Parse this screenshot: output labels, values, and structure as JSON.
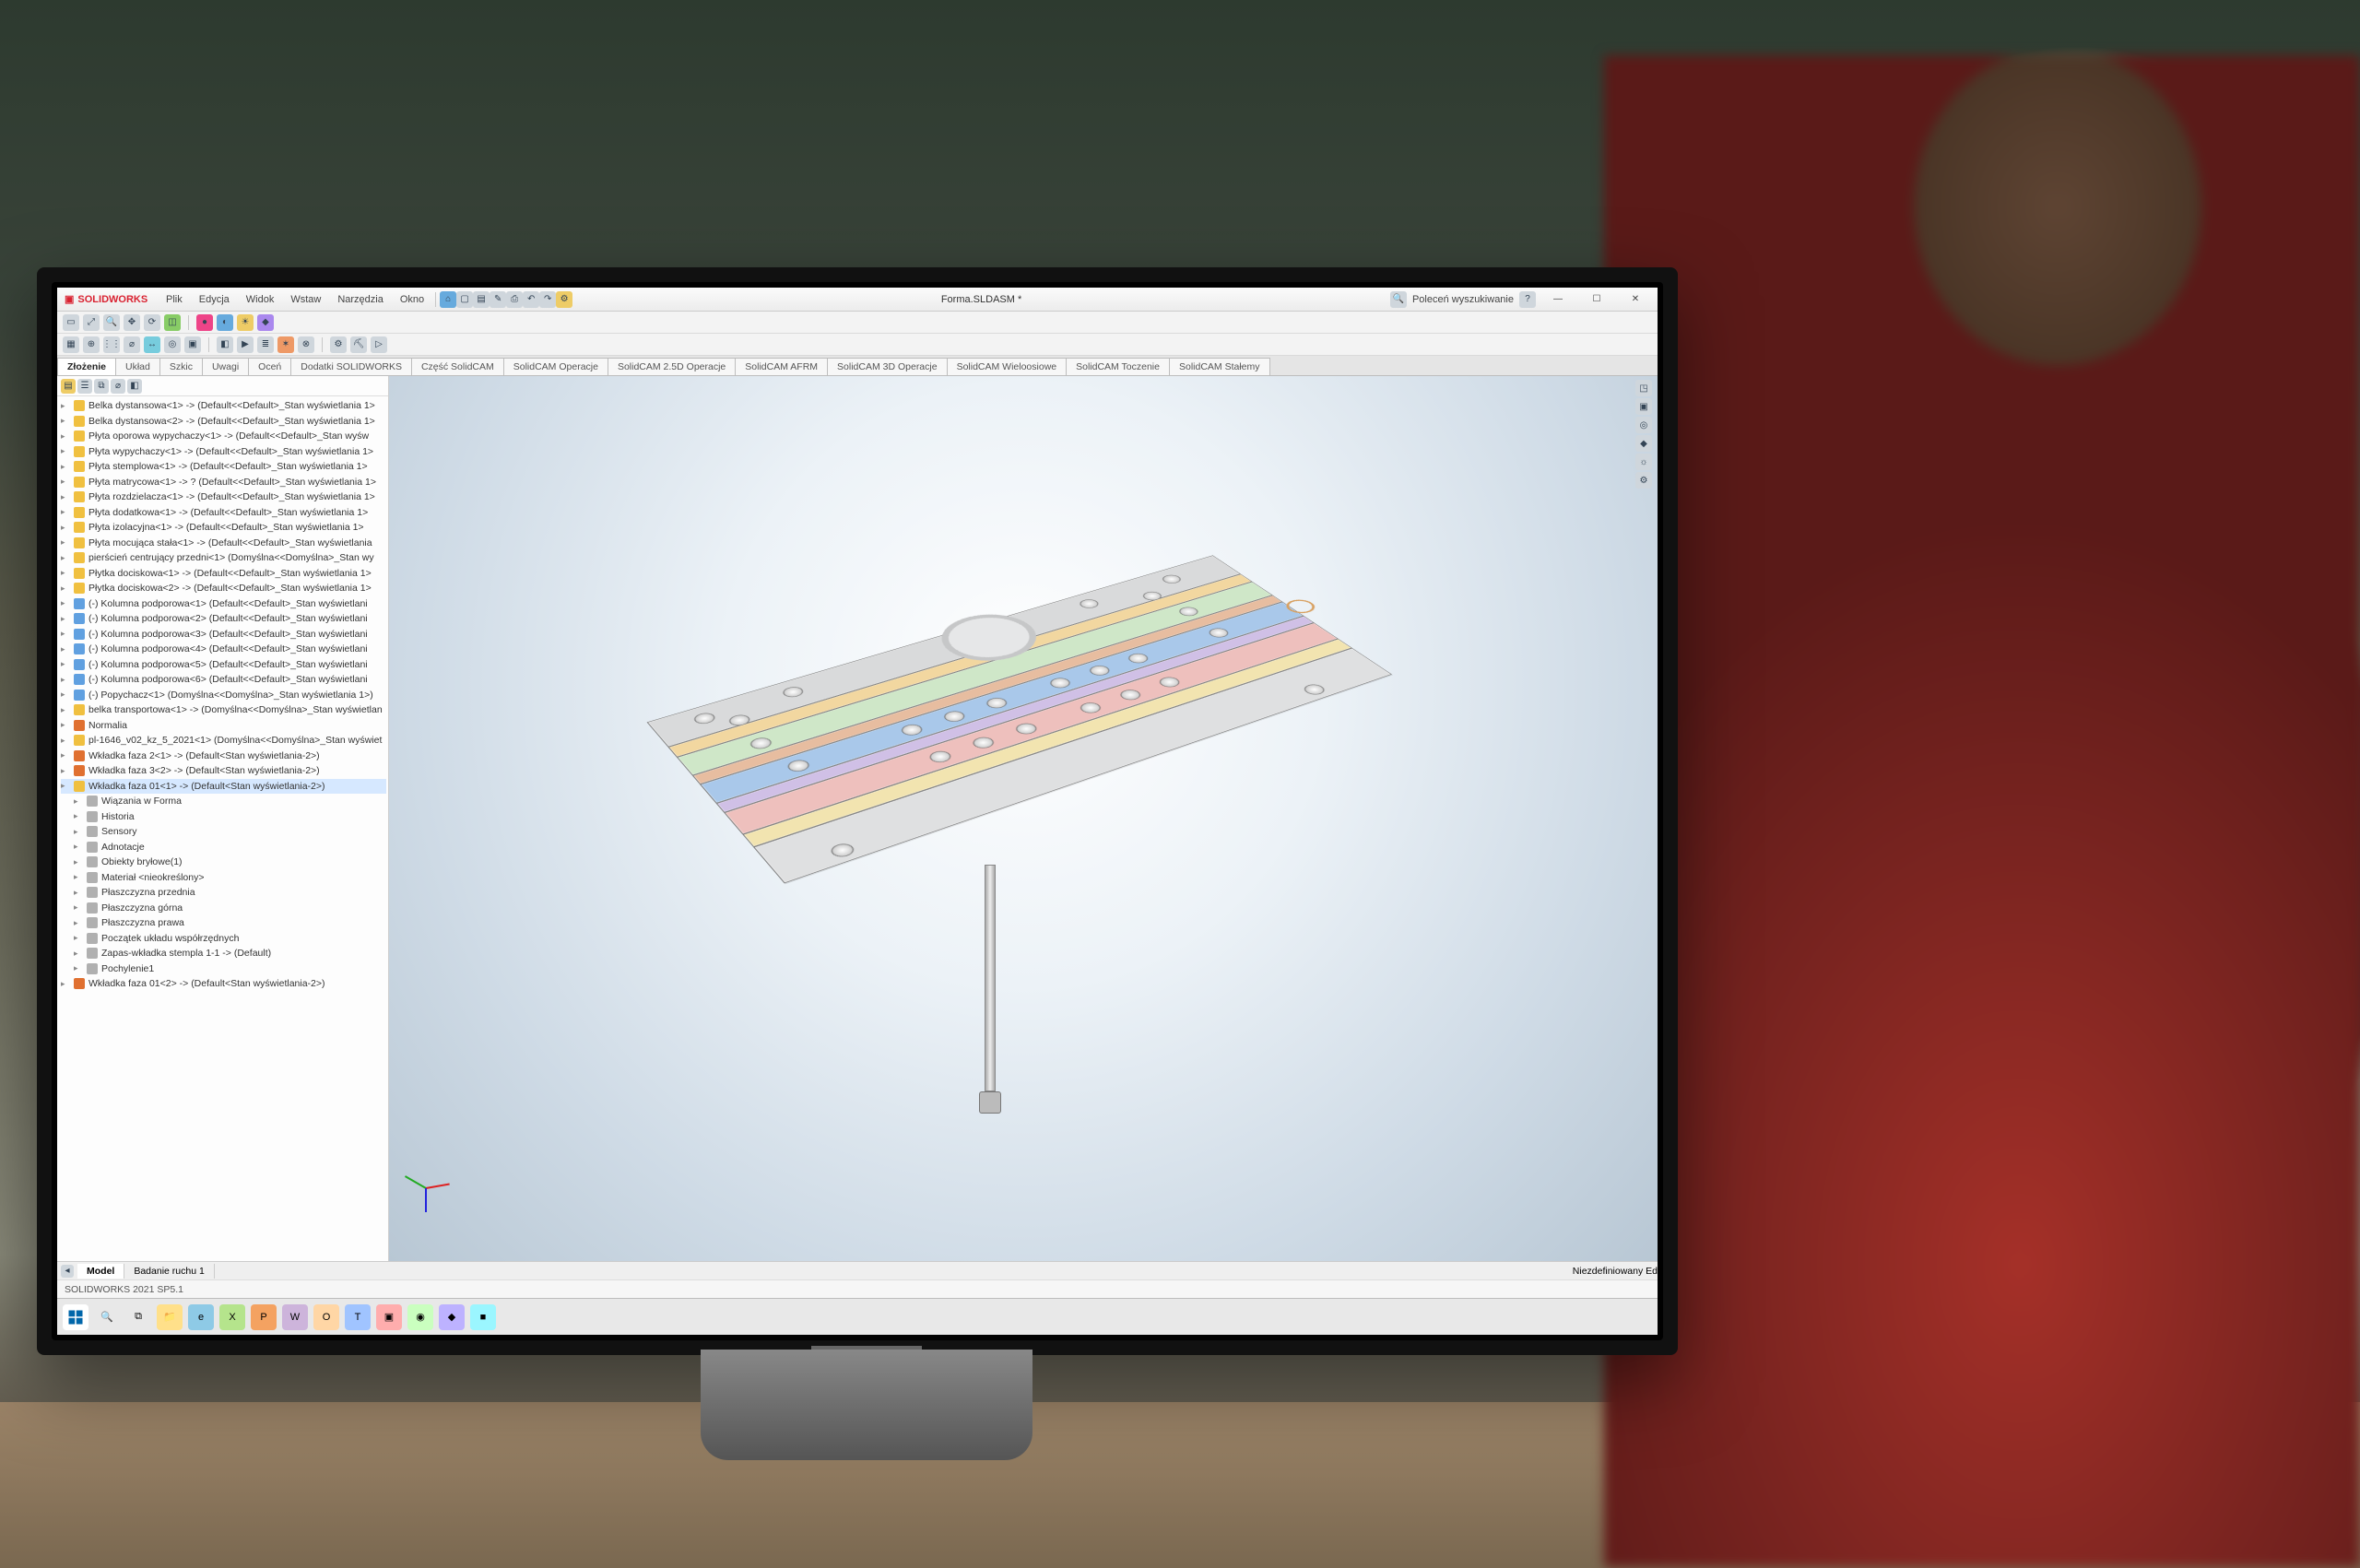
{
  "app": {
    "brand": "SOLIDWORKS",
    "document_title": "Forma.SLDASM *",
    "search_hint": "Poleceń wyszukiwanie"
  },
  "menu": [
    "Plik",
    "Edycja",
    "Widok",
    "Wstaw",
    "Narzędzia",
    "Okno"
  ],
  "ribbon_tabs": [
    "Złożenie",
    "Układ",
    "Szkic",
    "Uwagi",
    "Oceń",
    "Dodatki SOLIDWORKS",
    "Część SolidCAM",
    "SolidCAM Operacje",
    "SolidCAM 2.5D Operacje",
    "SolidCAM AFRM",
    "SolidCAM 3D Operacje",
    "SolidCAM Wieloosiowe",
    "SolidCAM Toczenie",
    "SolidCAM Stałemy"
  ],
  "active_tab": "Złożenie",
  "tree": [
    {
      "t": "Belka dystansowa<1> -> (Default<<Default>_Stan wyświetlania 1>",
      "k": "part"
    },
    {
      "t": "Belka dystansowa<2> -> (Default<<Default>_Stan wyświetlania 1>",
      "k": "part"
    },
    {
      "t": "Płyta oporowa wypychaczy<1> -> (Default<<Default>_Stan wyśw",
      "k": "part"
    },
    {
      "t": "Płyta wypychaczy<1> -> (Default<<Default>_Stan wyświetlania 1>",
      "k": "part"
    },
    {
      "t": "Płyta stemplowa<1> -> (Default<<Default>_Stan wyświetlania 1>",
      "k": "part"
    },
    {
      "t": "Płyta matrycowa<1> -> ? (Default<<Default>_Stan wyświetlania 1>",
      "k": "part"
    },
    {
      "t": "Płyta rozdzielacza<1> -> (Default<<Default>_Stan wyświetlania 1>",
      "k": "part"
    },
    {
      "t": "Płyta dodatkowa<1> -> (Default<<Default>_Stan wyświetlania 1>",
      "k": "part"
    },
    {
      "t": "Płyta izolacyjna<1> -> (Default<<Default>_Stan wyświetlania 1>",
      "k": "part"
    },
    {
      "t": "Płyta mocująca stała<1> -> (Default<<Default>_Stan wyświetlania",
      "k": "part"
    },
    {
      "t": "pierścień centrujący przedni<1> (Domyślna<<Domyślna>_Stan wy",
      "k": "part"
    },
    {
      "t": "Płytka dociskowa<1> -> (Default<<Default>_Stan wyświetlania 1>",
      "k": "part"
    },
    {
      "t": "Płytka dociskowa<2> -> (Default<<Default>_Stan wyświetlania 1>",
      "k": "part"
    },
    {
      "t": "(-) Kolumna podporowa<1> (Default<<Default>_Stan wyświetlani",
      "k": "sup"
    },
    {
      "t": "(-) Kolumna podporowa<2> (Default<<Default>_Stan wyświetlani",
      "k": "sup"
    },
    {
      "t": "(-) Kolumna podporowa<3> (Default<<Default>_Stan wyświetlani",
      "k": "sup"
    },
    {
      "t": "(-) Kolumna podporowa<4> (Default<<Default>_Stan wyświetlani",
      "k": "sup"
    },
    {
      "t": "(-) Kolumna podporowa<5> (Default<<Default>_Stan wyświetlani",
      "k": "sup"
    },
    {
      "t": "(-) Kolumna podporowa<6> (Default<<Default>_Stan wyświetlani",
      "k": "sup"
    },
    {
      "t": "(-) Popychacz<1> (Domyślna<<Domyślna>_Stan wyświetlania 1>)",
      "k": "sup"
    },
    {
      "t": "belka transportowa<1> -> (Domyślna<<Domyślna>_Stan wyświetlan",
      "k": "part"
    },
    {
      "t": "Normalia",
      "k": "warn"
    },
    {
      "t": "pl-1646_v02_kz_5_2021<1> (Domyślna<<Domyślna>_Stan wyświet",
      "k": "part"
    },
    {
      "t": "Wkładka faza 2<1> -> (Default<Stan wyświetlania-2>)",
      "k": "warn"
    },
    {
      "t": "Wkładka faza 3<2> -> (Default<Stan wyświetlania-2>)",
      "k": "warn"
    },
    {
      "t": "Wkładka faza 01<1> -> (Default<Stan wyświetlania-2>)",
      "k": "sel"
    },
    {
      "t": "Wiązania w Forma",
      "k": "sub",
      "i": 1
    },
    {
      "t": "Historia",
      "k": "sub",
      "i": 1
    },
    {
      "t": "Sensory",
      "k": "sub",
      "i": 1
    },
    {
      "t": "Adnotacje",
      "k": "sub",
      "i": 1
    },
    {
      "t": "Obiekty bryłowe(1)",
      "k": "sub",
      "i": 1
    },
    {
      "t": "Materiał <nieokreślony>",
      "k": "sub",
      "i": 1
    },
    {
      "t": "Płaszczyzna przednia",
      "k": "sub",
      "i": 1
    },
    {
      "t": "Płaszczyzna górna",
      "k": "sub",
      "i": 1
    },
    {
      "t": "Płaszczyzna prawa",
      "k": "sub",
      "i": 1
    },
    {
      "t": "Początek układu współrzędnych",
      "k": "sub",
      "i": 1
    },
    {
      "t": "Zapas-wkładka stempla 1-1 -> (Default)",
      "k": "sub",
      "i": 1
    },
    {
      "t": "Pochylenie1",
      "k": "sub",
      "i": 1
    },
    {
      "t": "Wkładka faza 01<2> -> (Default<Stan wyświetlania-2>)",
      "k": "warn"
    }
  ],
  "bottom_tabs": {
    "items": [
      "Model",
      "Badanie ruchu 1"
    ],
    "active": "Model",
    "right_label": "Niezdefiniowany   Ed"
  },
  "status": {
    "left": "SOLIDWORKS 2021 SP5.1",
    "right": ""
  },
  "winctrl": {
    "min": "—",
    "max": "☐",
    "close": "✕"
  }
}
